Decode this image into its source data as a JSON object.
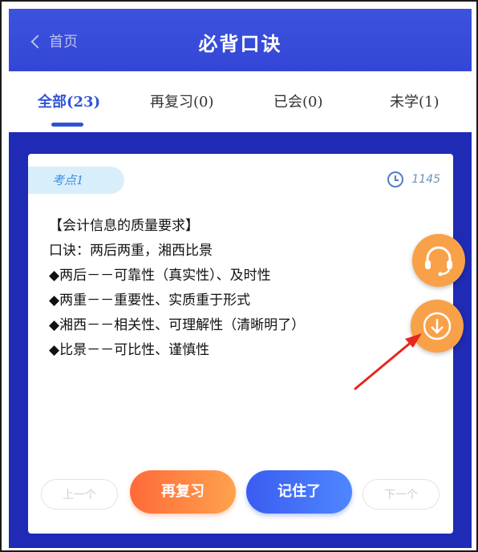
{
  "header": {
    "back_label": "首页",
    "title": "必背口诀"
  },
  "tabs": [
    {
      "label": "全部(23)",
      "active": true
    },
    {
      "label": "再复习(0)",
      "active": false
    },
    {
      "label": "已会(0)",
      "active": false
    },
    {
      "label": "未学(1)",
      "active": false
    }
  ],
  "card": {
    "badge": "考点1",
    "count": "1145",
    "lines": [
      "【会计信息的质量要求】",
      "口诀：两后两重，湘西比景",
      "◆两后－－可靠性（真实性）、及时性",
      "◆两重－－重要性、实质重于形式",
      "◆湘西－－相关性、可理解性（清晰明了）",
      "◆比景－－可比性、谨慎性"
    ]
  },
  "buttons": {
    "prev": "上一个",
    "review": "再复习",
    "got_it": "记住了",
    "next": "下一个"
  },
  "icons": {
    "clock": "clock-icon",
    "headset": "headset-icon",
    "download": "download-icon"
  },
  "colors": {
    "accent": "#2f55d6",
    "header": "#3446d6",
    "orange": "#f9a148",
    "annotation": "#e8261d"
  }
}
